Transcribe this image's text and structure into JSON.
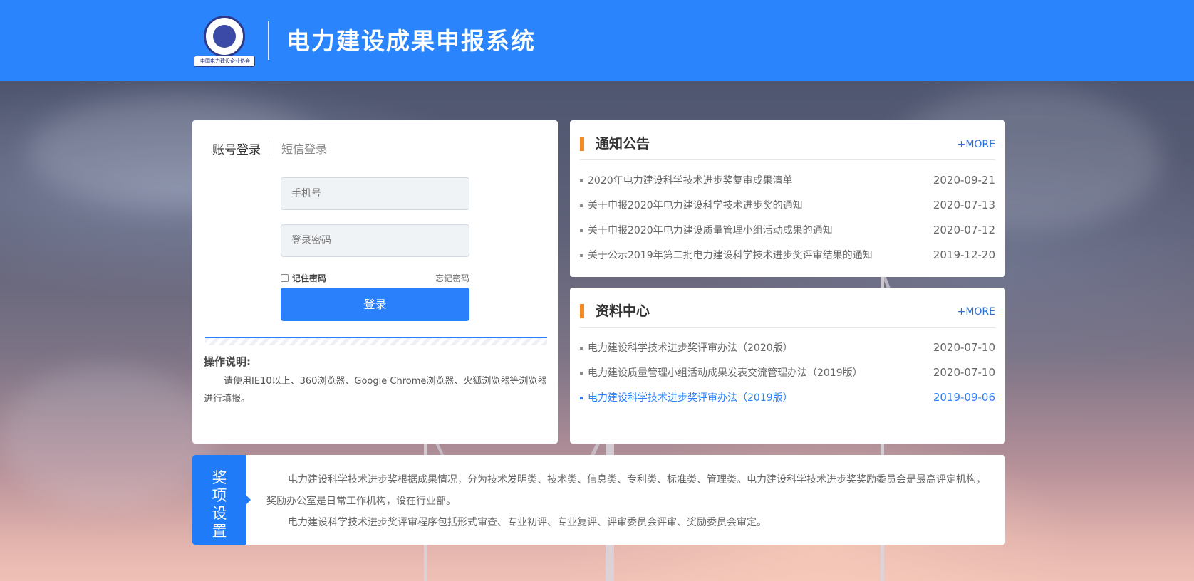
{
  "header": {
    "logo_text": "中国电力建设企业协会",
    "title": "电力建设成果申报系统"
  },
  "login": {
    "tab_account": "账号登录",
    "tab_sms": "短信登录",
    "phone_placeholder": "手机号",
    "password_placeholder": "登录密码",
    "remember_label": "记住密码",
    "forgot_label": "忘记密码",
    "submit_label": "登录",
    "instructions_title": "操作说明:",
    "instructions_text": "请使用IE10以上、360浏览器、Google Chrome浏览器、火狐浏览器等浏览器进行填报。"
  },
  "notices": {
    "title": "通知公告",
    "more": "+MORE",
    "items": [
      {
        "text": "2020年电力建设科学技术进步奖复审成果清单",
        "date": "2020-09-21"
      },
      {
        "text": "关于申报2020年电力建设科学技术进步奖的通知",
        "date": "2020-07-13"
      },
      {
        "text": "关于申报2020年电力建设质量管理小组活动成果的通知",
        "date": "2020-07-12"
      },
      {
        "text": "关于公示2019年第二批电力建设科学技术进步奖评审结果的通知",
        "date": "2019-12-20"
      }
    ]
  },
  "resources": {
    "title": "资料中心",
    "more": "+MORE",
    "items": [
      {
        "text": "电力建设科学技术进步奖评审办法（2020版）",
        "date": "2020-07-10"
      },
      {
        "text": "电力建设质量管理小组活动成果发表交流管理办法（2019版）",
        "date": "2020-07-10"
      },
      {
        "text": "电力建设科学技术进步奖评审办法（2019版）",
        "date": "2019-09-06"
      }
    ]
  },
  "award": {
    "side_label": "奖项设置",
    "paragraph1": "电力建设科学技术进步奖根据成果情况，分为技术发明类、技术类、信息类、专利类、标准类、管理类。电力建设科学技术进步奖奖励委员会是最高评定机构，奖励办公室是日常工作机构，设在行业部。",
    "paragraph2": "电力建设科学技术进步奖评审程序包括形式审查、专业初评、专业复评、评审委员会评审、奖励委员会审定。"
  },
  "colors": {
    "header_blue": "#2a84fc",
    "accent_blue": "#2a7ffb",
    "accent_orange": "#f58a22"
  }
}
